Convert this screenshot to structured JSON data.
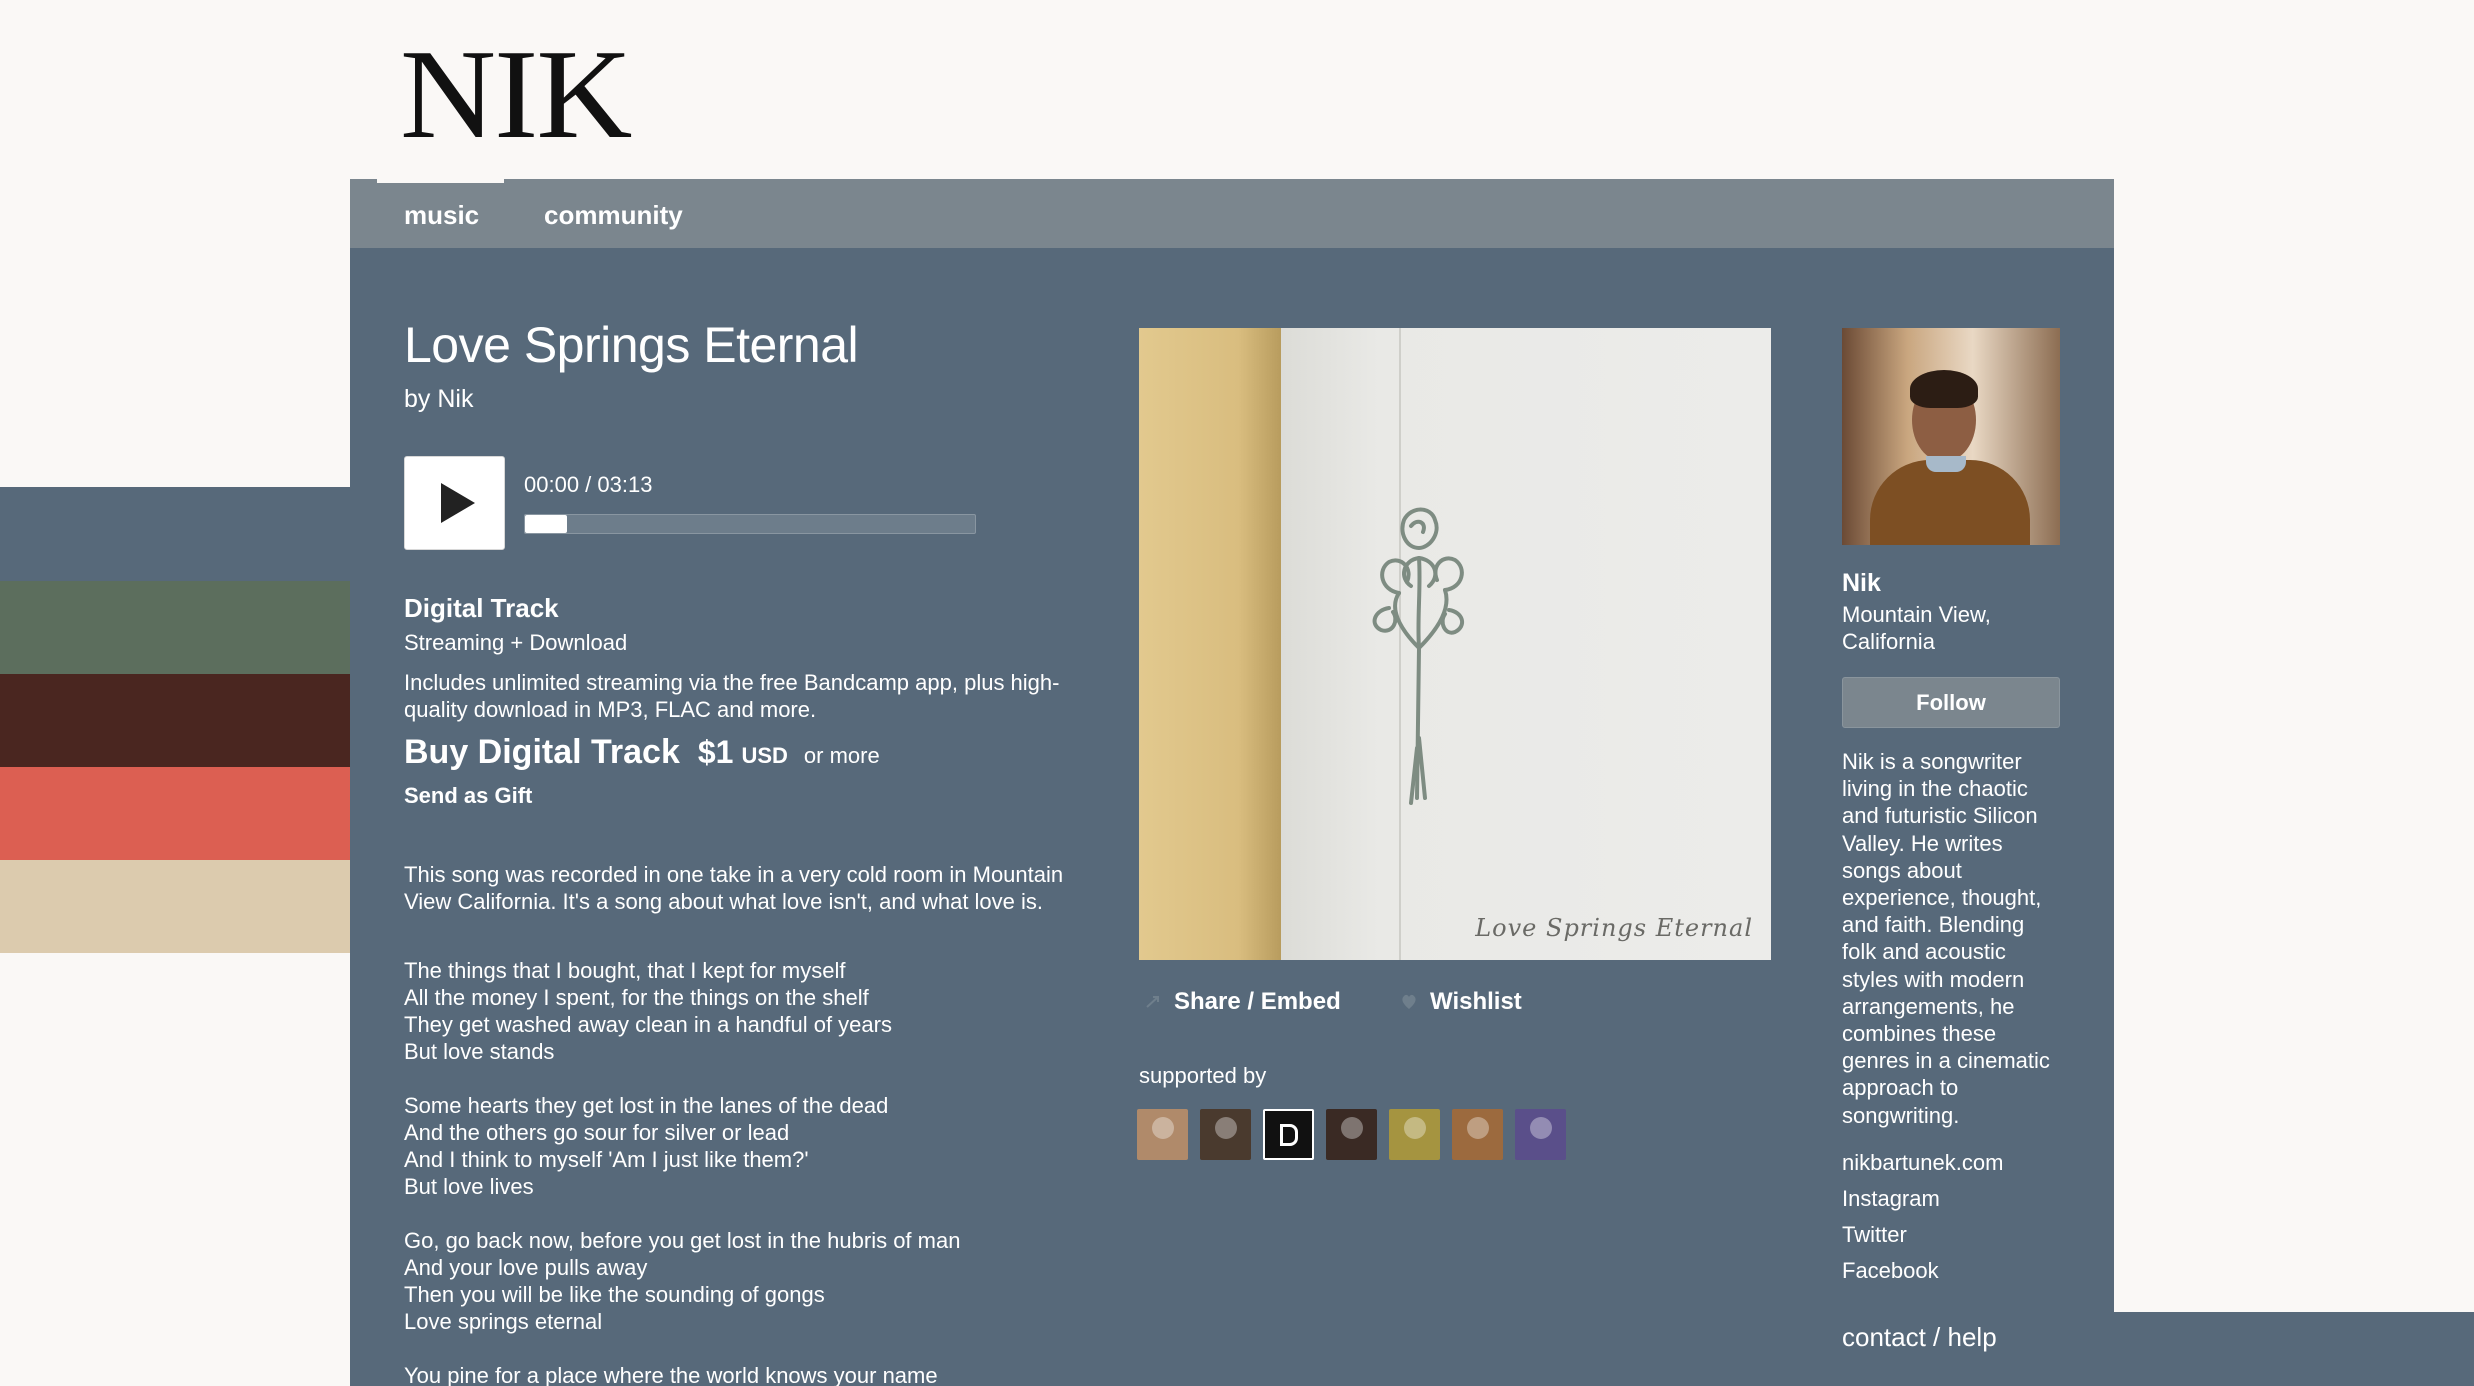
{
  "header": {
    "logo_text": "NIK"
  },
  "nav": {
    "music": "music",
    "community": "community"
  },
  "track": {
    "title": "Love Springs Eternal",
    "byline": "by Nik"
  },
  "player": {
    "time": "00:00 / 03:13",
    "progress": 0.0
  },
  "purchase": {
    "format_title": "Digital Track",
    "format_sub": "Streaming + Download",
    "description": "Includes unlimited streaming via the free Bandcamp app, plus high-quality download in MP3, FLAC and more.",
    "buy_label": "Buy Digital Track",
    "price": "$1",
    "currency": "USD",
    "or_more": "or more",
    "gift": "Send as Gift"
  },
  "about": "This song was recorded in one take in a very cold room in Mountain View California. It's a song about what love isn't, and what love is.",
  "lyrics": [
    [
      "The things that I bought, that I kept for myself",
      "All the money I spent, for the things on the shelf",
      "They get washed away clean in a handful of years",
      "But love stands"
    ],
    [
      "Some hearts they get lost in the lanes of the dead",
      "And the others go sour for silver or lead",
      "And I think to myself 'Am I just like them?'",
      "But love lives"
    ],
    [
      "Go, go back now, before you get lost in the hubris of man",
      "And your love pulls away",
      "Then you will be like the sounding of gongs",
      "Love springs eternal"
    ],
    [
      "You pine for a place where the world knows your name"
    ]
  ],
  "album_art": {
    "signature": "Love Springs Eternal"
  },
  "actions": {
    "share": "Share / Embed",
    "wishlist": "Wishlist"
  },
  "supported_by": {
    "label": "supported by",
    "avatars": [
      {
        "icon": "supporter-avatar",
        "color": "#b08a6a"
      },
      {
        "icon": "supporter-avatar",
        "color": "#4a3a2e"
      },
      {
        "icon": "supporter-avatar-r",
        "color": "#111111"
      },
      {
        "icon": "supporter-avatar",
        "color": "#3a2a24"
      },
      {
        "icon": "supporter-avatar",
        "color": "#a59440"
      },
      {
        "icon": "supporter-avatar",
        "color": "#9c6a3e"
      },
      {
        "icon": "supporter-avatar",
        "color": "#5a4f8a"
      }
    ]
  },
  "artist": {
    "name": "Nik",
    "location": "Mountain View, California",
    "follow": "Follow",
    "bio": "Nik is a songwriter living in the chaotic and futuristic Silicon Valley. He writes songs about experience, thought, and faith. Blending folk and acoustic styles with modern arrangements, he combines these genres in a cinematic approach to songwriting.",
    "links": [
      "nikbartunek.com",
      "Instagram",
      "Twitter",
      "Facebook"
    ],
    "contact": "contact / help"
  },
  "colors": {
    "panel": "#57697a",
    "nav": "#7b868e",
    "swatches": [
      "#57697a",
      "#5c6e5d",
      "#4a2620",
      "#dc5f52",
      "#dccbae"
    ]
  }
}
